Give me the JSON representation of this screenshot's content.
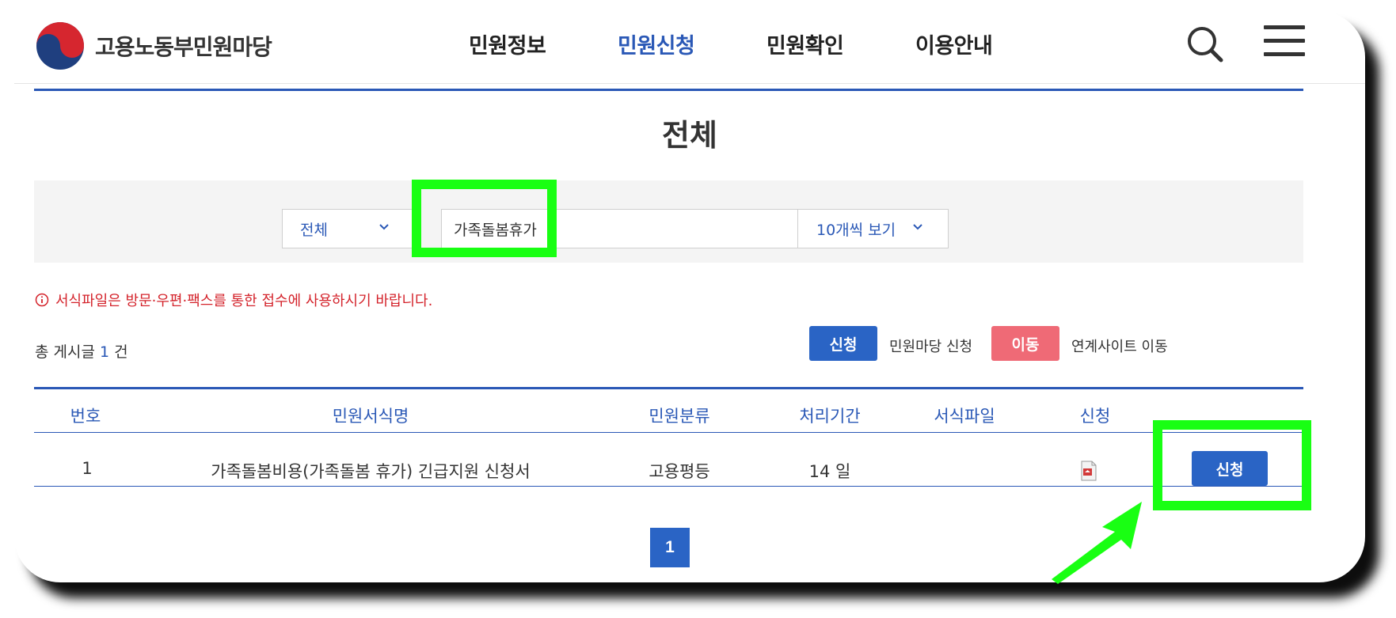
{
  "header": {
    "logo_text": "고용노동부민원마당",
    "nav": [
      "민원정보",
      "민원신청",
      "민원확인",
      "이용안내"
    ],
    "active_nav": "민원신청"
  },
  "page_title": "전체",
  "search": {
    "category": "전체",
    "keyword": "가족돌봄휴가",
    "page_size": "10개씩 보기"
  },
  "notice": "서식파일은 방문·우편·팩스를 통한 접수에 사용하시기 바랍니다.",
  "total": {
    "prefix": "총 게시글",
    "count": "1",
    "suffix": "건"
  },
  "legend": {
    "apply_button": "신청",
    "apply_label": "민원마당 신청",
    "move_button": "이동",
    "move_label": "연계사이트 이동"
  },
  "table": {
    "headers": [
      "번호",
      "민원서식명",
      "민원분류",
      "처리기간",
      "서식파일",
      "신청"
    ],
    "rows": [
      {
        "no": "1",
        "name": "가족돌봄비용(가족돌봄 휴가) 긴급지원 신청서",
        "category": "고용평등",
        "period": "14 일",
        "file": "file-pdf-icon",
        "action": "신청"
      }
    ]
  },
  "pagination": {
    "current": "1"
  },
  "colors": {
    "primary": "#2a58b6",
    "button": "#2a64c5",
    "move": "#ef6a76",
    "notice": "#d4232b",
    "highlight": "#19ff13"
  }
}
